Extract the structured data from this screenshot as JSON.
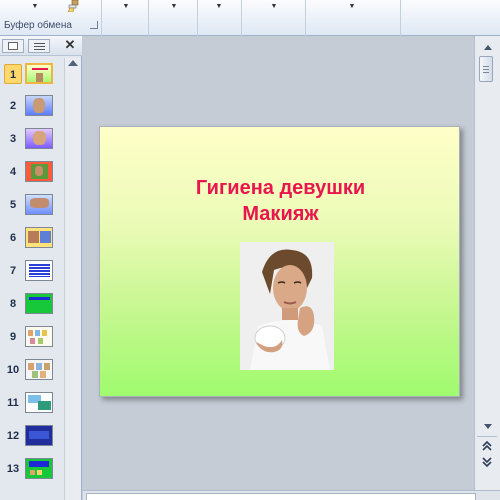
{
  "ribbon": {
    "clipboard_label": "Буфер обмена"
  },
  "slides_pane": {
    "thumbnails": [
      {
        "number": "1",
        "selected": true
      },
      {
        "number": "2"
      },
      {
        "number": "3"
      },
      {
        "number": "4"
      },
      {
        "number": "5"
      },
      {
        "number": "6"
      },
      {
        "number": "7"
      },
      {
        "number": "8"
      },
      {
        "number": "9"
      },
      {
        "number": "10"
      },
      {
        "number": "11"
      },
      {
        "number": "12"
      },
      {
        "number": "13"
      }
    ]
  },
  "slide": {
    "title_line1": "Гигиена  девушки",
    "title_line2": "Макияж",
    "title_color": "#e8154e",
    "gradient_top": "#ffffc8",
    "gradient_bottom": "#9ffb6e"
  },
  "icons": {
    "format_painter": "brush-icon",
    "slides_tab": "slides-tab-icon",
    "outline_tab": "outline-tab-icon",
    "close": "close-icon",
    "prev_slide": "prev-slide-icon",
    "next_slide": "next-slide-icon"
  }
}
